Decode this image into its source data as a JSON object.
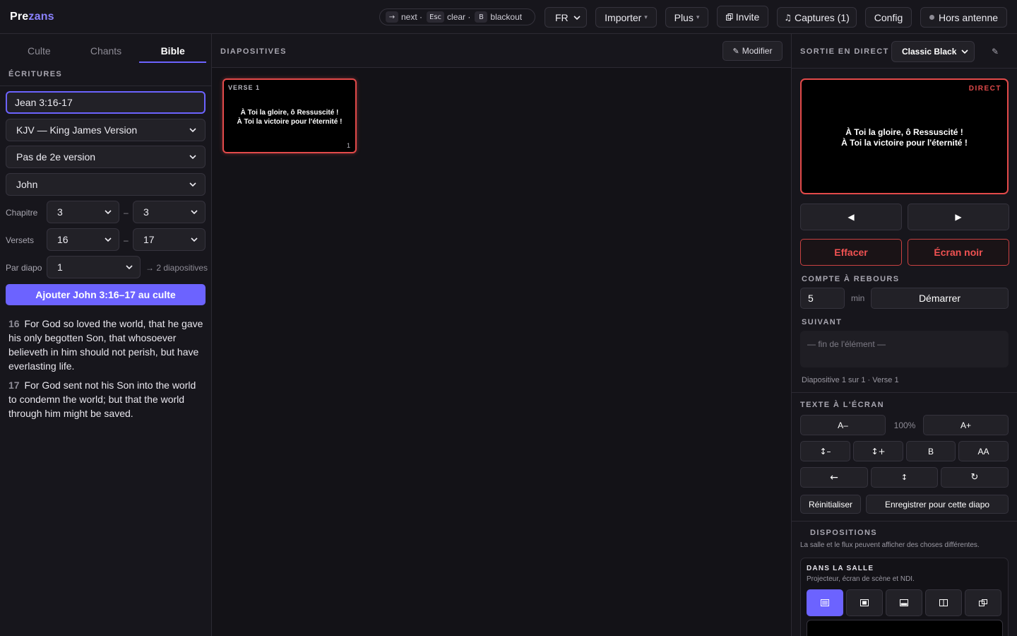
{
  "app": {
    "logo_a": "Pre",
    "logo_b": "zans"
  },
  "topbar": {
    "shortcuts": [
      {
        "key": "→",
        "word": "next ·"
      },
      {
        "key": "Esc",
        "word": "clear ·"
      },
      {
        "key": "B",
        "word": "blackout"
      }
    ],
    "language": "FR",
    "import_label": "Importer",
    "more_label": "Plus",
    "invite_label": "Invite",
    "captures_label": "Captures (1)",
    "config_label": "Config",
    "status_label": "Hors antenne"
  },
  "left": {
    "tabs": [
      "Culte",
      "Chants",
      "Bible"
    ],
    "section_title": "ÉCRITURES",
    "reference_value": "Jean 3:16-17",
    "version": "KJV — King James Version",
    "second_version": "Pas de 2e version",
    "book": "John",
    "chapter_label": "Chapitre",
    "chapter_from": "3",
    "chapter_to": "3",
    "verses_label": "Versets",
    "verse_from": "16",
    "verse_to": "17",
    "per_slide_label": "Par diapo",
    "per_slide_value": "1",
    "slides_hint": "→ 2 diapositives",
    "dash": "–",
    "add_button": "Ajouter John 3:16–17 au culte",
    "verses": [
      {
        "num": "16",
        "text": "For God so loved the world, that he gave his only begotten Son, that whosoever believeth in him should not perish, but have everlasting life."
      },
      {
        "num": "17",
        "text": "For God sent not his Son into the world to condemn the world; but that the world through him might be saved."
      }
    ]
  },
  "center": {
    "title": "DIAPOSITIVES",
    "edit_label": "Modifier",
    "slide": {
      "tag": "VERSE 1",
      "line1": "À Toi la gloire, ô Ressuscité !",
      "line2": "À Toi la victoire pour l'éternité !",
      "number": "1"
    }
  },
  "right": {
    "title": "SORTIE EN DIRECT",
    "theme": "Classic Black",
    "live_badge": "DIRECT",
    "live_line1": "À Toi la gloire, ô Ressuscité !",
    "live_line2": "À Toi la victoire pour l'éternité !",
    "clear_label": "Effacer",
    "black_label": "Écran noir",
    "countdown_title": "COMPTE À REBOURS",
    "countdown_value": "5",
    "countdown_unit": "min",
    "start_label": "Démarrer",
    "next_title": "SUIVANT",
    "next_text": "— fin de l'élément —",
    "status": "Diapositive 1 sur 1 · Verse 1",
    "text_title": "TEXTE À L'ÉCRAN",
    "font_smaller": "A–",
    "zoom": "100%",
    "font_bigger": "A+",
    "line_less": "↕–",
    "line_more": "↕+",
    "bold": "B",
    "caps": "AA",
    "reset_label": "Réinitialiser",
    "save_label": "Enregistrer pour cette diapo",
    "layouts_title": "DISPOSITIONS",
    "layouts_sub": "La salle et le flux peuvent afficher des choses différentes.",
    "room_title": "DANS LA SALLE",
    "room_sub": "Projecteur, écran de scène et NDI."
  },
  "colors": {
    "accent": "#6c63ff",
    "live": "#e24a4a",
    "bg": "#17161c"
  }
}
